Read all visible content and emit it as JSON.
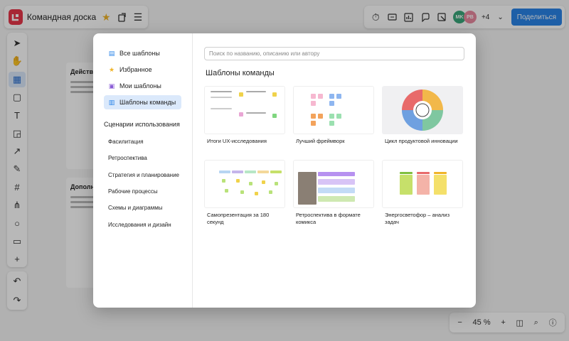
{
  "app": {
    "board_title": "Командная доска",
    "share_label": "Поделиться",
    "avatars": [
      {
        "initials": "MK",
        "color": "#3aa77a"
      },
      {
        "initials": "PB",
        "color": "#e98aa0"
      }
    ],
    "more_users": "+4",
    "zoom": "45 %"
  },
  "canvas": {
    "card1_title": "Действ",
    "card2_title": "Дополн"
  },
  "modal": {
    "nav": [
      {
        "label": "Все шаблоны",
        "icon": "all-templates-icon",
        "active": false
      },
      {
        "label": "Избранное",
        "icon": "star-icon",
        "active": false
      },
      {
        "label": "Мои шаблоны",
        "icon": "my-templates-icon",
        "active": false
      },
      {
        "label": "Шаблоны команды",
        "icon": "team-templates-icon",
        "active": true
      }
    ],
    "scenarios_title": "Сценарии использования",
    "scenarios": [
      "Фасилитация",
      "Ретроспектива",
      "Стратегия и планирование",
      "Рабочие процессы",
      "Схемы и диаграммы",
      "Исследования и дизайн"
    ],
    "search_placeholder": "Поиск по названию, описанию или автору",
    "grid_title": "Шаблоны команды",
    "templates": [
      {
        "name": "Итоги UX-исследования"
      },
      {
        "name": "Лучший фреймворк"
      },
      {
        "name": "Цикл продуктовой инновации"
      },
      {
        "name": "Самопрезентация за 180 секунд"
      },
      {
        "name": "Ретроспектива в формате комикса"
      },
      {
        "name": "Энергосветофор – анализ задач"
      }
    ]
  },
  "colors": {
    "accent": "#2a84e8",
    "logo": "#e8374a",
    "active_nav_bg": "#dbe9fb"
  }
}
